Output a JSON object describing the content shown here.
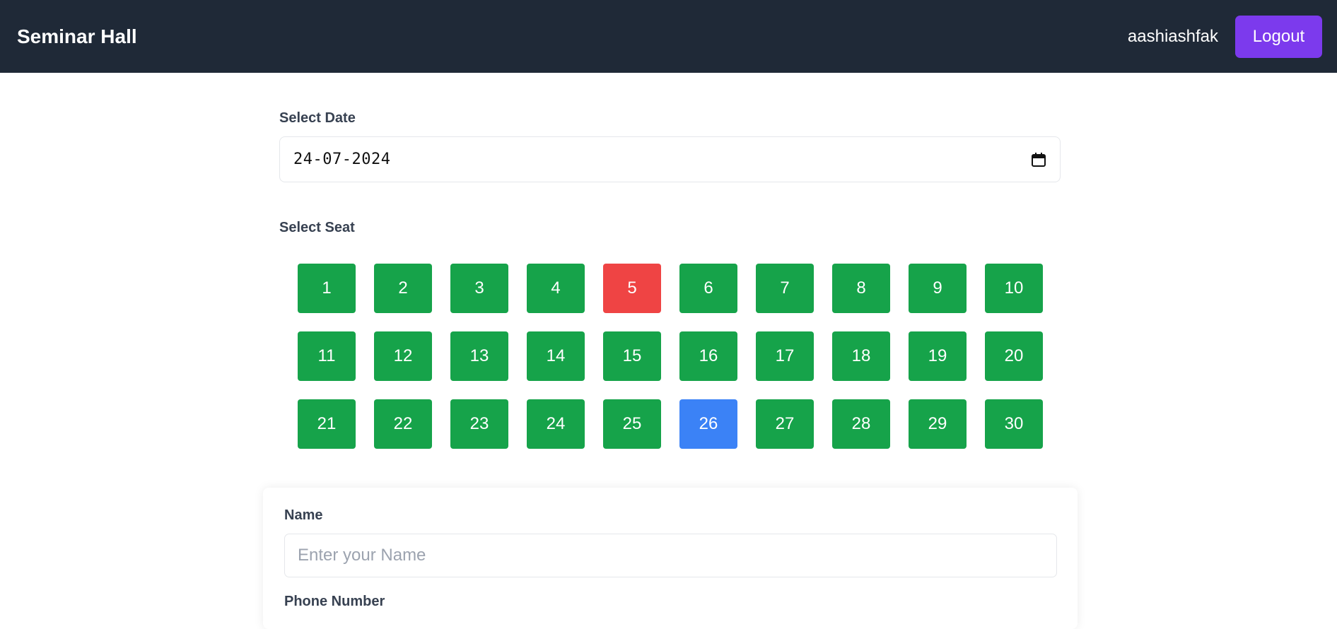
{
  "header": {
    "brand": "Seminar Hall",
    "username": "aashiashfak",
    "logout_label": "Logout"
  },
  "date_section": {
    "label": "Select Date",
    "value": "24-07-2024",
    "icon": "calendar-icon"
  },
  "seat_section": {
    "label": "Select Seat",
    "colors": {
      "available": "#16a34a",
      "booked": "#ef4444",
      "selected": "#3b82f6"
    },
    "seats": [
      {
        "number": "1",
        "status": "available"
      },
      {
        "number": "2",
        "status": "available"
      },
      {
        "number": "3",
        "status": "available"
      },
      {
        "number": "4",
        "status": "available"
      },
      {
        "number": "5",
        "status": "booked"
      },
      {
        "number": "6",
        "status": "available"
      },
      {
        "number": "7",
        "status": "available"
      },
      {
        "number": "8",
        "status": "available"
      },
      {
        "number": "9",
        "status": "available"
      },
      {
        "number": "10",
        "status": "available"
      },
      {
        "number": "11",
        "status": "available"
      },
      {
        "number": "12",
        "status": "available"
      },
      {
        "number": "13",
        "status": "available"
      },
      {
        "number": "14",
        "status": "available"
      },
      {
        "number": "15",
        "status": "available"
      },
      {
        "number": "16",
        "status": "available"
      },
      {
        "number": "17",
        "status": "available"
      },
      {
        "number": "18",
        "status": "available"
      },
      {
        "number": "19",
        "status": "available"
      },
      {
        "number": "20",
        "status": "available"
      },
      {
        "number": "21",
        "status": "available"
      },
      {
        "number": "22",
        "status": "available"
      },
      {
        "number": "23",
        "status": "available"
      },
      {
        "number": "24",
        "status": "available"
      },
      {
        "number": "25",
        "status": "available"
      },
      {
        "number": "26",
        "status": "selected"
      },
      {
        "number": "27",
        "status": "available"
      },
      {
        "number": "28",
        "status": "available"
      },
      {
        "number": "29",
        "status": "available"
      },
      {
        "number": "30",
        "status": "available"
      }
    ]
  },
  "form": {
    "name_label": "Name",
    "name_placeholder": "Enter your Name",
    "name_value": "",
    "phone_label": "Phone Number"
  }
}
